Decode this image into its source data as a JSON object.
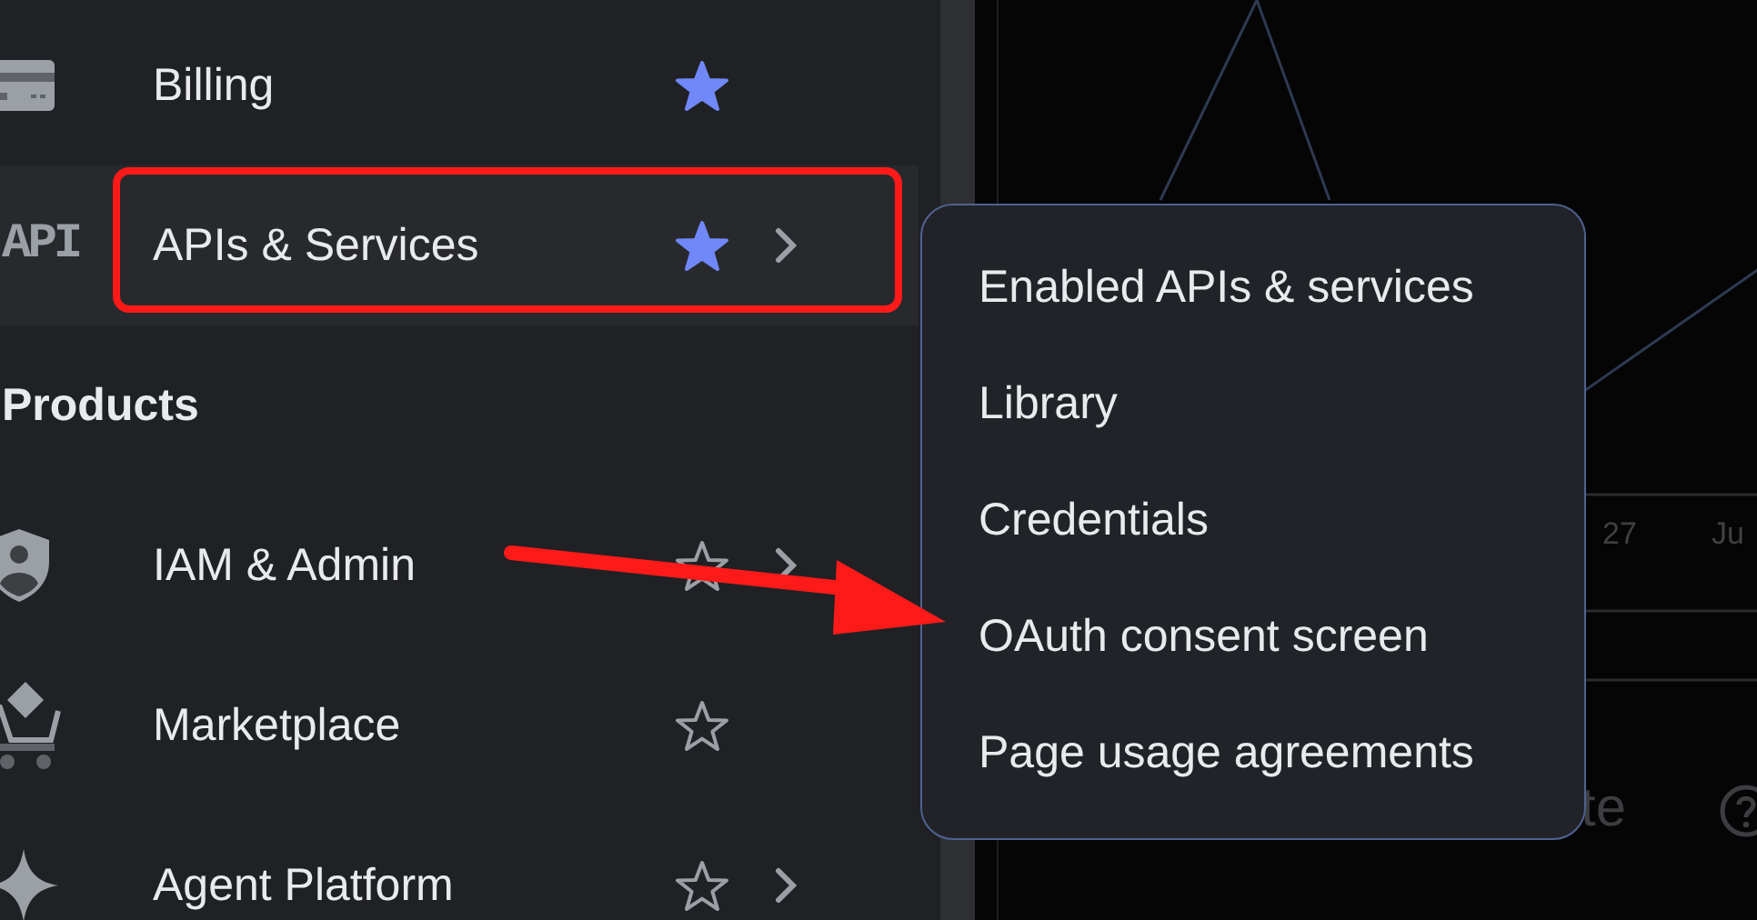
{
  "sidebar": {
    "rows": [
      {
        "kind": "item",
        "label": "Billing",
        "starred": true,
        "has_submenu": false,
        "highlighted": false,
        "annotated": false
      },
      {
        "kind": "item",
        "icon_text": "API",
        "label": "APIs & Services",
        "starred": true,
        "has_submenu": true,
        "highlighted": true,
        "annotated": true
      },
      {
        "kind": "header",
        "label": "Products"
      },
      {
        "kind": "item",
        "label": "IAM & Admin",
        "starred": false,
        "has_submenu": true,
        "highlighted": false,
        "annotated": false
      },
      {
        "kind": "item",
        "label": "Marketplace",
        "starred": false,
        "has_submenu": false,
        "highlighted": false,
        "annotated": false
      },
      {
        "kind": "item",
        "label": "Agent Platform",
        "starred": false,
        "has_submenu": true,
        "highlighted": false,
        "annotated": false
      }
    ]
  },
  "submenu": {
    "items": [
      {
        "label": "Enabled APIs & services",
        "arrow_points_here": false
      },
      {
        "label": "Library",
        "arrow_points_here": false
      },
      {
        "label": "Credentials",
        "arrow_points_here": false
      },
      {
        "label": "OAuth consent screen",
        "arrow_points_here": true
      },
      {
        "label": "Page usage agreements",
        "arrow_points_here": false
      }
    ]
  },
  "background": {
    "tick_labels": [
      "27",
      "Ju"
    ],
    "title_fragment": "te"
  }
}
